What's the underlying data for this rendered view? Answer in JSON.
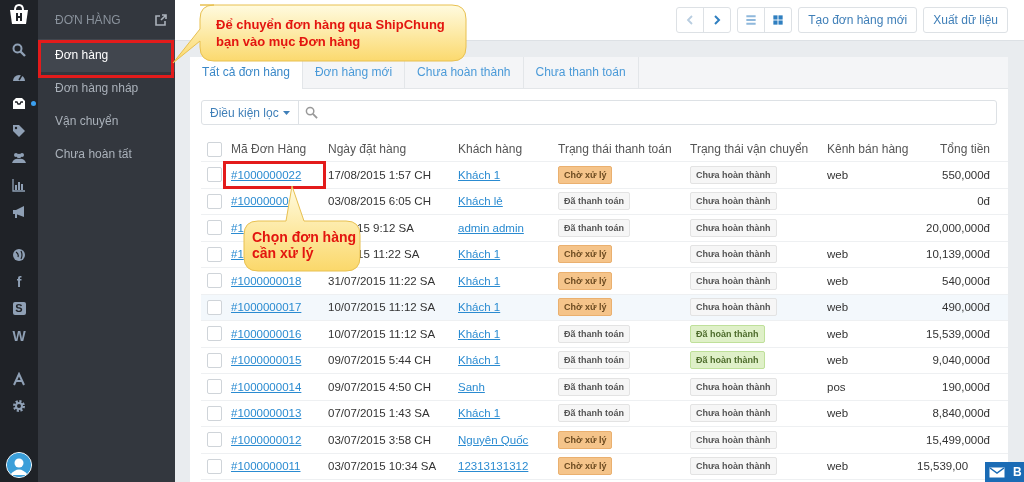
{
  "rail": {
    "groups": [
      [
        {
          "selected": false
        },
        {
          "selected": false
        },
        {
          "selected": true
        },
        {
          "selected": false
        },
        {
          "selected": false
        },
        {
          "selected": false
        },
        {
          "selected": false
        }
      ],
      [
        {
          "selected": false
        },
        {
          "text": "f",
          "selected": false
        },
        {
          "text": "S",
          "selected": false
        },
        {
          "text": "W",
          "selected": false
        }
      ],
      [
        {
          "selected": false
        },
        {
          "selected": false
        }
      ]
    ]
  },
  "sidebar": {
    "title": "ĐƠN HÀNG",
    "items": [
      {
        "label": "Đơn hàng",
        "selected": true
      },
      {
        "label": "Đơn hàng nháp",
        "selected": false
      },
      {
        "label": "Vận chuyển",
        "selected": false
      },
      {
        "label": "Chưa hoàn tất",
        "selected": false
      }
    ]
  },
  "toolbar": {
    "buttons": [
      "Tạo đơn hàng mới",
      "Xuất dữ liệu"
    ]
  },
  "tabs": [
    {
      "label": "Tất cả đơn hàng",
      "selected": true
    },
    {
      "label": "Đơn hàng mới",
      "selected": false
    },
    {
      "label": "Chưa hoàn thành",
      "selected": false
    },
    {
      "label": "Chưa thanh toán",
      "selected": false
    }
  ],
  "filter": {
    "label": "Điều kiện lọc"
  },
  "table": {
    "all_checked": false,
    "columns": [
      "Mã Đơn Hàng",
      "Ngày đặt hàng",
      "Khách hàng",
      "Trạng thái thanh toán",
      "Trạng thái vận chuyển",
      "Kênh bán hàng",
      "Tổng tiền"
    ],
    "rows": [
      {
        "id": "#1000000022",
        "date": "17/08/2015 1:57 CH",
        "customer": "Khách 1",
        "payment": {
          "kind": "pending",
          "label": "Chờ xử lý"
        },
        "shipping": {
          "kind": "incomplete",
          "label": "Chưa hoàn thành"
        },
        "channel": "web",
        "total": "550,000đ",
        "highlighted": false
      },
      {
        "id": "#10000000",
        "date": "03/08/2015 6:05 CH",
        "customer": "Khách lẻ",
        "payment": {
          "kind": "paid",
          "label": "Đã thanh toán"
        },
        "shipping": {
          "kind": "incomplete",
          "label": "Chưa hoàn thành"
        },
        "total": "0đ",
        "highlighted": false
      },
      {
        "id": "#1",
        "date": "15 9:12 SA",
        "customer": "admin admin",
        "payment": {
          "kind": "paid",
          "label": "Đã thanh toán"
        },
        "shipping": {
          "kind": "incomplete",
          "label": "Chưa hoàn thành"
        },
        "total": "20,000,000đ",
        "highlighted": false
      },
      {
        "id": "#1",
        "date": "15 11:22 SA",
        "customer": "Khách 1",
        "payment": {
          "kind": "pending",
          "label": "Chờ xử lý"
        },
        "shipping": {
          "kind": "incomplete",
          "label": "Chưa hoàn thành"
        },
        "channel": "web",
        "total": "10,139,000đ",
        "highlighted": false
      },
      {
        "id": "#1000000018",
        "date": "31/07/2015 11:22 SA",
        "customer": "Khách 1",
        "payment": {
          "kind": "pending",
          "label": "Chờ xử lý"
        },
        "shipping": {
          "kind": "incomplete",
          "label": "Chưa hoàn thành"
        },
        "channel": "web",
        "total": "540,000đ",
        "highlighted": false
      },
      {
        "id": "#1000000017",
        "date": "10/07/2015 11:12 SA",
        "customer": "Khách 1",
        "payment": {
          "kind": "pending",
          "label": "Chờ xử lý"
        },
        "shipping": {
          "kind": "incomplete",
          "label": "Chưa hoàn thành"
        },
        "channel": "web",
        "total": "490,000đ",
        "highlighted": true
      },
      {
        "id": "#1000000016",
        "date": "10/07/2015 11:12 SA",
        "customer": "Khách 1",
        "payment": {
          "kind": "paid",
          "label": "Đã thanh toán"
        },
        "shipping": {
          "kind": "done",
          "label": "Đã hoàn thành"
        },
        "channel": "web",
        "total": "15,539,000đ",
        "highlighted": false
      },
      {
        "id": "#1000000015",
        "date": "09/07/2015 5:44 CH",
        "customer": "Khách 1",
        "payment": {
          "kind": "paid",
          "label": "Đã thanh toán"
        },
        "shipping": {
          "kind": "done",
          "label": "Đã hoàn thành"
        },
        "channel": "web",
        "total": "9,040,000đ",
        "highlighted": false
      },
      {
        "id": "#1000000014",
        "date": "09/07/2015 4:50 CH",
        "customer": "Sanh",
        "payment": {
          "kind": "paid",
          "label": "Đã thanh toán"
        },
        "shipping": {
          "kind": "incomplete",
          "label": "Chưa hoàn thành"
        },
        "channel": "pos",
        "total": "190,000đ",
        "highlighted": false
      },
      {
        "id": "#1000000013",
        "date": "07/07/2015 1:43 SA",
        "customer": "Khách 1",
        "payment": {
          "kind": "paid",
          "label": "Đã thanh toán"
        },
        "shipping": {
          "kind": "incomplete",
          "label": "Chưa hoàn thành"
        },
        "channel": "web",
        "total": "8,840,000đ",
        "highlighted": false
      },
      {
        "id": "#1000000012",
        "date": "03/07/2015 3:58 CH",
        "customer": "Nguyên Quốc",
        "payment": {
          "kind": "pending",
          "label": "Chờ xử lý"
        },
        "shipping": {
          "kind": "incomplete",
          "label": "Chưa hoàn thành"
        },
        "total": "15,499,000đ",
        "highlighted": false
      },
      {
        "id": "#1000000011",
        "date": "03/07/2015 10:34 SA",
        "customer": "12313131312",
        "payment": {
          "kind": "pending",
          "label": "Chờ xử lý"
        },
        "shipping": {
          "kind": "incomplete",
          "label": "Chưa hoàn thành"
        },
        "channel": "web",
        "total": "15,539,00",
        "highlighted": false
      }
    ]
  },
  "callouts": [
    "Để chuyển đơn hàng qua ShipChung bạn vào mục Đơn hàng",
    "Chọn đơn hàng cần xử lý"
  ],
  "chat_widget": {
    "label": "B"
  }
}
